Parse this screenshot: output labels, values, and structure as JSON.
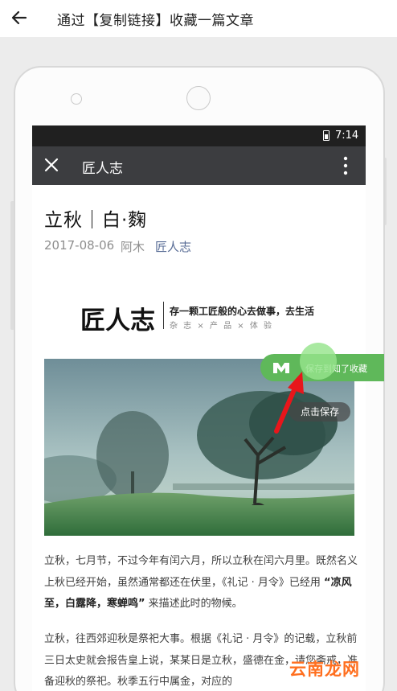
{
  "header": {
    "back_icon": "back-arrow-icon",
    "title": "通过【复制链接】收藏一篇文章"
  },
  "phone": {
    "status": {
      "time": "7:14",
      "battery_icon": "battery-icon"
    },
    "appbar": {
      "close_icon": "close-icon",
      "title": "匠人志",
      "more_icon": "more-vertical-icon"
    },
    "article": {
      "title": "立秋｜白·麴",
      "date": "2017-08-06",
      "author": "阿木",
      "account": "匠人志",
      "brand": {
        "logo_text": "匠人志",
        "slogan": "存一颗工匠般的心去做事，去生活",
        "tags": "杂 志 × 产 品 × 体 验"
      },
      "image": "misty-tree-landscape",
      "paragraphs": {
        "p1_a": "立秋，七月节，不过今年有闰六月，所以立秋在闰六月里。既然名义上秋已经开始，虽然通常都还在伏里，《礼记 · 月令》已经用 ",
        "p1_bold": "“凉风至，白露降，寒蝉鸣”",
        "p1_b": " 来描述此时的物候。",
        "p2": "立秋，往西郊迎秋是祭祀大事。根据《礼记 · 月令》的记载，立秋前三日太史就会报告皇上说，某某日是立秋，盛德在金，请您斋戒，准备迎秋的祭祀。秋季五行中属金，对应的"
      }
    },
    "overlay": {
      "save_pill_icon": "m-logo-icon",
      "save_pill_text": "保存到知了收藏",
      "click_hint": "点击保存",
      "arrow_icon": "red-arrow-icon"
    }
  },
  "watermark": "云南龙网",
  "colors": {
    "accent_green": "#5fb85a",
    "link_blue": "#576b95",
    "appbar": "#3c3d40",
    "arrow_red": "#e8161b",
    "watermark_orange": "#ff6f1f"
  }
}
